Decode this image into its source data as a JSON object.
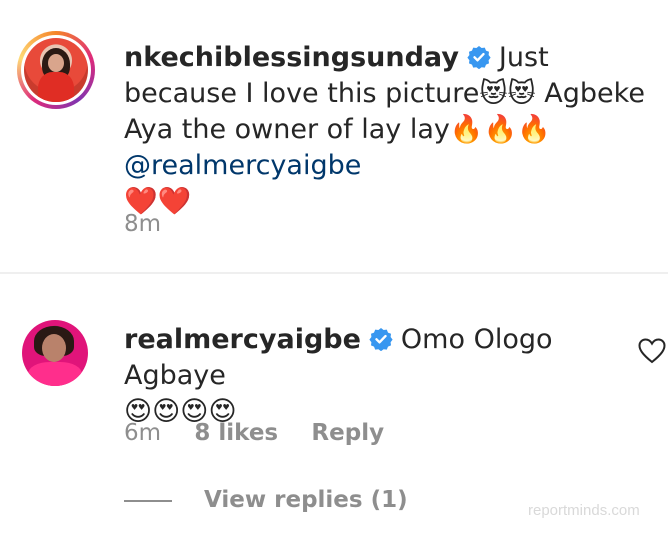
{
  "post_caption": {
    "username": "nkechiblessingsunday",
    "text_part1": "Just because I love this picture",
    "emoji_cats": "😻😻",
    "text_part2": " Agbeke Aya the owner of lay lay",
    "emoji_fire": "🔥🔥🔥",
    "mention": "@realmercyaigbe",
    "emoji_hearts": "❤️❤️",
    "time": "8m"
  },
  "comment": {
    "username": "realmercyaigbe",
    "text": "Omo Ologo Agbaye",
    "emoji": "😍😍😍😍",
    "time": "6m",
    "likes": "8 likes",
    "reply_label": "Reply",
    "view_replies": "View replies (1)"
  },
  "watermark": "reportminds.com",
  "colors": {
    "verified_blue": "#3897f0",
    "text": "#262626",
    "secondary": "#8e8e8e",
    "mention": "#00376b"
  }
}
